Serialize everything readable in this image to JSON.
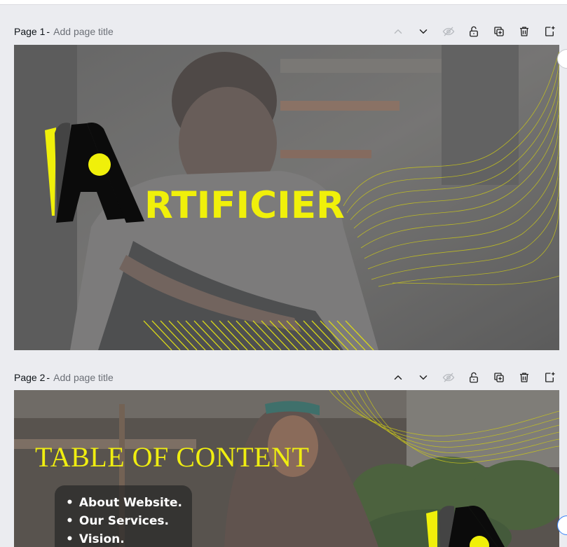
{
  "pages": [
    {
      "number_label": "Page 1",
      "separator": "-",
      "placeholder": "Add page title",
      "slide": {
        "brand_suffix": "RTIFICIER"
      }
    },
    {
      "number_label": "Page 2",
      "separator": "-",
      "placeholder": "Add page title",
      "slide": {
        "heading": "TABLE OF CONTENT",
        "items": [
          "About Website.",
          "Our Services.",
          "Vision."
        ]
      }
    }
  ],
  "toolbar_icons": [
    "chevron-up-icon",
    "chevron-down-icon",
    "hide-icon",
    "lock-icon",
    "duplicate-icon",
    "trash-icon",
    "add-page-icon"
  ],
  "colors": {
    "accent": "#f0f00a",
    "background": "#ebecf0",
    "text": "#0e1318",
    "muted": "#6b6f76"
  }
}
